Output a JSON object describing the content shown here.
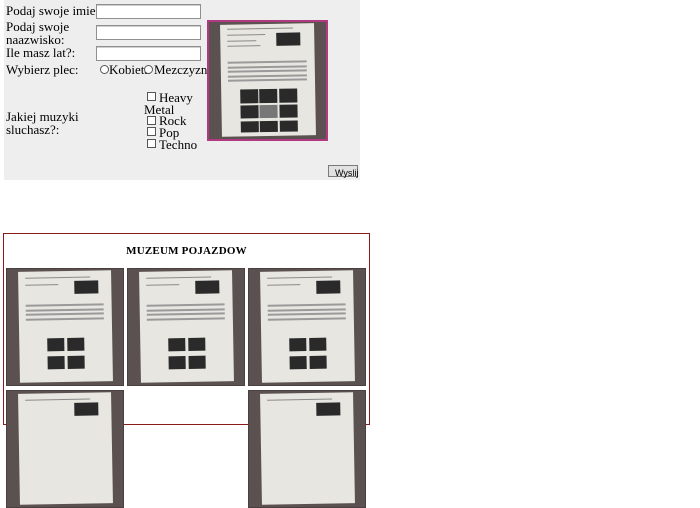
{
  "form": {
    "first_name_label": "Podaj swoje imie:",
    "last_name_label_line1": "Podaj swoje",
    "last_name_label_line2": "naazwisko:",
    "age_label": "Ile masz lat?:",
    "gender_label": "Wybierz plec:",
    "gender_options": [
      "Kobieta",
      "Mezczyzna"
    ],
    "music_label_line1": "Jakiej muzyki",
    "music_label_line2": "sluchasz?:",
    "music_options": [
      "Heavy",
      "Metal",
      "Rock",
      "Pop",
      "Techno"
    ],
    "submit_label": "Wyslij",
    "first_name_value": "",
    "last_name_value": "",
    "age_value": ""
  },
  "gallery": {
    "title": "MUZEUM POJAZDOW"
  },
  "colors": {
    "panel_bg": "#eeeeee",
    "preview_border": "#b0397f",
    "gallery_border": "#8b1a1a"
  }
}
